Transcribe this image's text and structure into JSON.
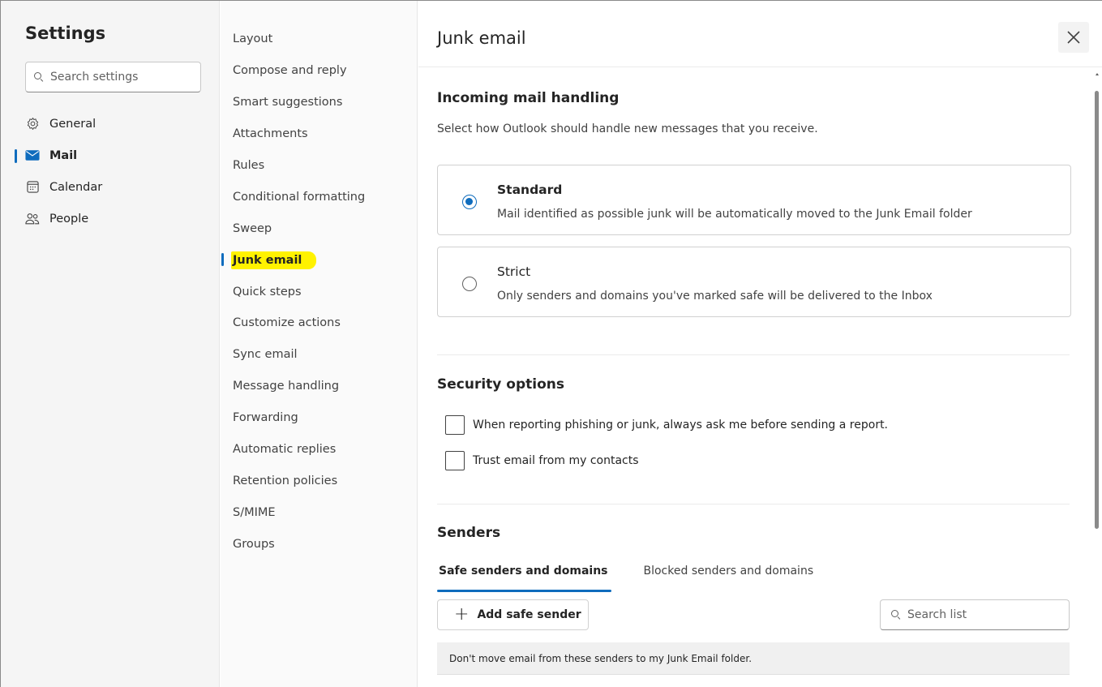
{
  "left": {
    "title": "Settings",
    "search_placeholder": "Search settings",
    "categories": [
      {
        "label": "General",
        "icon": "gear-icon"
      },
      {
        "label": "Mail",
        "icon": "mail-icon"
      },
      {
        "label": "Calendar",
        "icon": "calendar-icon"
      },
      {
        "label": "People",
        "icon": "people-icon"
      }
    ]
  },
  "middle": {
    "items": [
      "Layout",
      "Compose and reply",
      "Smart suggestions",
      "Attachments",
      "Rules",
      "Conditional formatting",
      "Sweep",
      "Junk email",
      "Quick steps",
      "Customize actions",
      "Sync email",
      "Message handling",
      "Forwarding",
      "Automatic replies",
      "Retention policies",
      "S/MIME",
      "Groups"
    ]
  },
  "right": {
    "title": "Junk email",
    "incoming": {
      "title": "Incoming mail handling",
      "description": "Select how Outlook should handle new messages that you receive.",
      "options": [
        {
          "title": "Standard",
          "description": "Mail identified as possible junk will be automatically moved to the Junk Email folder",
          "checked": true
        },
        {
          "title": "Strict",
          "description": "Only senders and domains you've marked safe will be delivered to the Inbox",
          "checked": false
        }
      ]
    },
    "security": {
      "title": "Security options",
      "options": [
        {
          "label": "When reporting phishing or junk, always ask me before sending a report.",
          "checked": false
        },
        {
          "label": "Trust email from my contacts",
          "checked": false
        }
      ]
    },
    "senders": {
      "title": "Senders",
      "tabs": [
        "Safe senders and domains",
        "Blocked senders and domains"
      ],
      "add_button": "Add safe sender",
      "search_placeholder": "Search list",
      "info": "Don't move email from these senders to my Junk Email folder."
    }
  },
  "colors": {
    "accent": "#0f6cbd",
    "highlight": "#fff200"
  }
}
